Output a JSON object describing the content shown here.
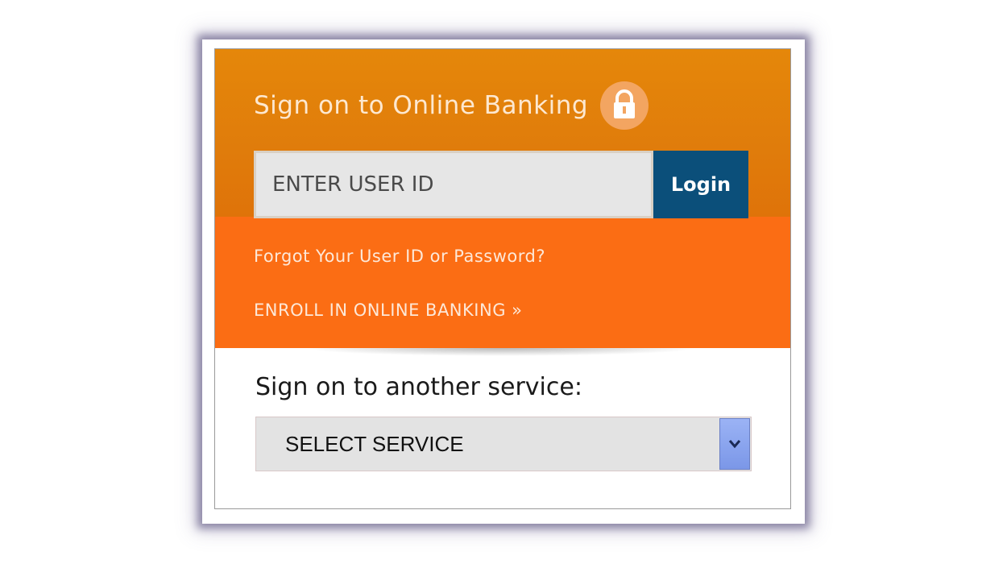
{
  "signon": {
    "title": "Sign on to Online Banking",
    "lock_icon": "lock-icon",
    "userid_placeholder": "ENTER USER ID",
    "userid_value": "",
    "login_label": "Login"
  },
  "links": {
    "forgot": "Forgot Your User ID or Password?",
    "enroll": "ENROLL IN ONLINE BANKING »"
  },
  "service": {
    "label": "Sign on to another service:",
    "selected": "SELECT SERVICE",
    "dropdown_icon": "chevron-down-icon"
  },
  "colors": {
    "header_orange": "#e5870a",
    "link_orange": "#fb6d14",
    "login_blue": "#0b4f7a"
  }
}
